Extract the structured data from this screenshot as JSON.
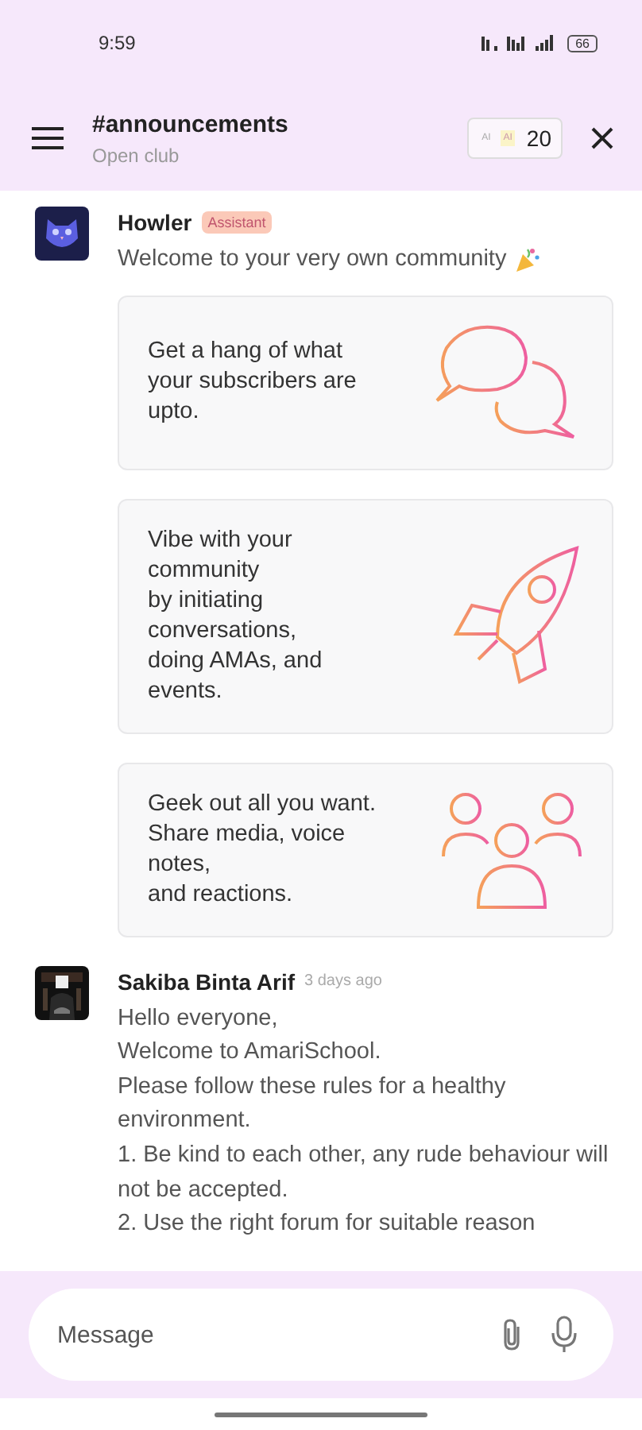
{
  "status_bar": {
    "time": "9:59",
    "battery": "66"
  },
  "header": {
    "title": "#announcements",
    "subtitle": "Open club",
    "credits": {
      "chips": [
        "AI",
        "AI"
      ],
      "count": "20"
    }
  },
  "messages": [
    {
      "kind": "assistant",
      "author": "Howler",
      "badge": "Assistant",
      "text": [
        "Welcome to your very own community"
      ],
      "cards": [
        {
          "text": "Get a hang of what\nyour subscribers are\nupto.",
          "kind": "chat"
        },
        {
          "text": "Vibe with your\ncommunity\nby initiating\nconversations,\ndoing AMAs, and\nevents.",
          "kind": "rocket"
        },
        {
          "text": "Geek out all you want.\nShare media, voice\nnotes,\nand reactions.",
          "kind": "people"
        }
      ]
    },
    {
      "kind": "member",
      "author": "Sakiba Binta Arif",
      "time": "3 days ago",
      "text": [
        "Hello everyone,",
        "Welcome to AmariSchool.",
        "Please follow these rules for a healthy environment.",
        "1. Be kind to each other, any rude behaviour will not be accepted.",
        "2. Use the right forum for suitable reason"
      ]
    }
  ],
  "composer": {
    "placeholder": "Message"
  }
}
